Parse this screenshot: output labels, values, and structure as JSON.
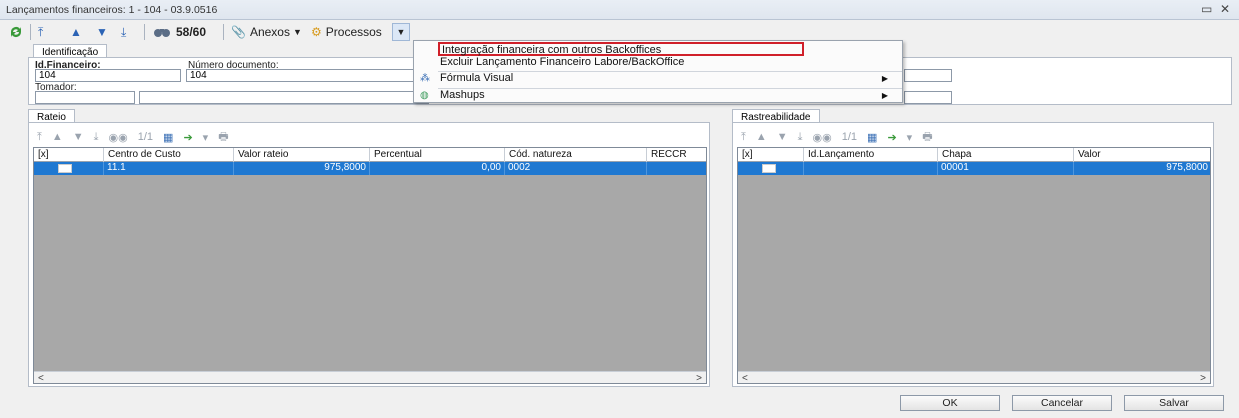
{
  "window": {
    "title": "Lançamentos financeiros: 1 - 104 - 03.9.0516",
    "restore_icon": "restore-icon",
    "close_icon": "close-icon"
  },
  "toolbar": {
    "record_counter": "58/60",
    "attachments_label": "Anexos",
    "processes_label": "Processos"
  },
  "process_menu": {
    "items": [
      {
        "label": "Integração financeira com outros Backoffices",
        "has_submenu": false
      },
      {
        "label": "Excluir Lançamento Financeiro Labore/BackOffice",
        "has_submenu": false
      },
      {
        "label": "Fórmula Visual",
        "has_submenu": true
      },
      {
        "label": "Mashups",
        "has_submenu": true
      }
    ]
  },
  "identification": {
    "tab_label": "Identificação",
    "id_label": "Id.Financeiro:",
    "id_value": "104",
    "doc_label": "Número documento:",
    "doc_value": "104",
    "taker_label": "Tomador:",
    "taker_value": "",
    "taker_name": ""
  },
  "rateio": {
    "tab_label": "Rateio",
    "pager": "1/1",
    "columns": [
      "[x]",
      "Centro de Custo",
      "Valor rateio",
      "Percentual",
      "Cód. natureza",
      "RECCR"
    ],
    "rows": [
      [
        "",
        "11.1",
        "975,8000",
        "0,00",
        "0002",
        ""
      ]
    ]
  },
  "rastreabilidade": {
    "tab_label": "Rastreabilidade",
    "pager": "1/1",
    "columns": [
      "[x]",
      "Id.Lançamento",
      "Chapa",
      "Valor"
    ],
    "rows": [
      [
        "",
        "",
        "00001",
        "975,8000"
      ]
    ]
  },
  "buttons": {
    "ok": "OK",
    "cancel": "Cancelar",
    "save": "Salvar"
  },
  "colors": {
    "selected_row": "#1f78d1",
    "grid_bg": "#a8a8a8",
    "highlight_border": "#d0202a"
  }
}
